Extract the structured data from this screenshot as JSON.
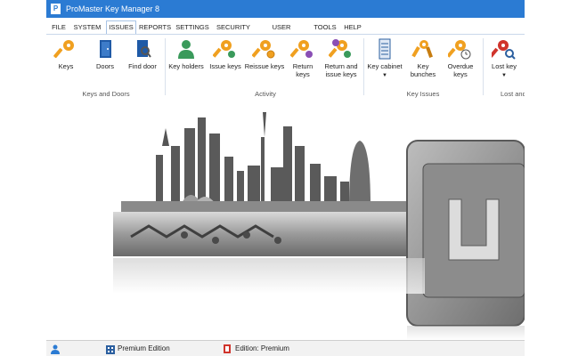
{
  "window": {
    "title": "ProMaster Key Manager 8"
  },
  "colors": {
    "titlebar": "#2b7bd3",
    "accent": "#f0a020",
    "holder": "#3a9a5b",
    "status": "#f2f2f2"
  },
  "menu": [
    {
      "label": "FILE"
    },
    {
      "label": "SYSTEM"
    },
    {
      "label": "ISSUES",
      "active": true
    },
    {
      "label": "REPORTS"
    },
    {
      "label": "SETTINGS"
    },
    {
      "label": "SECURITY"
    },
    {
      "label": "USER SETTINGS"
    },
    {
      "label": "TOOLS"
    },
    {
      "label": "HELP"
    }
  ],
  "ribbon": {
    "groups": [
      {
        "label": "Keys and Doors"
      },
      {
        "label": "Activity"
      },
      {
        "label": "Key Issues"
      },
      {
        "label": "Lost and"
      }
    ],
    "buttons": [
      {
        "label": "Keys",
        "icon": "key-icon"
      },
      {
        "label": "Doors",
        "icon": "door-icon"
      },
      {
        "label": "Find door",
        "icon": "find-door-icon"
      },
      {
        "label": "Key holders",
        "icon": "person-icon"
      },
      {
        "label": "Issue keys",
        "icon": "issue-key-icon"
      },
      {
        "label": "Reissue keys",
        "icon": "reissue-key-icon"
      },
      {
        "label": "Return keys",
        "icon": "return-key-icon"
      },
      {
        "label": "Return and",
        "label2": "issue keys",
        "icon": "return-issue-key-icon"
      },
      {
        "label": "Key cabinet",
        "icon": "cabinet-icon"
      },
      {
        "label": "Key",
        "label2": "bunches",
        "icon": "key-bunch-icon"
      },
      {
        "label": "Overdue",
        "label2": "keys",
        "icon": "overdue-key-icon"
      },
      {
        "label": "Lost key",
        "icon": "lost-key-icon"
      }
    ]
  },
  "status": {
    "edition": "Premium Edition",
    "edition_detail": "Edition: Premium"
  }
}
